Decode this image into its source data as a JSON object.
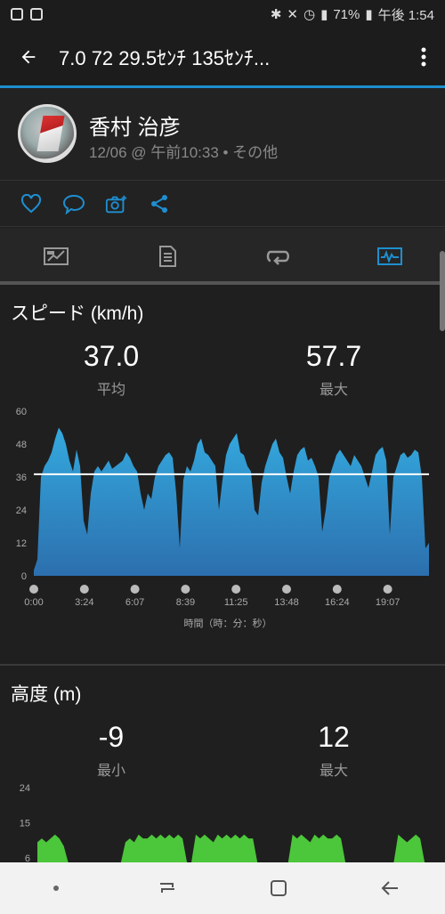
{
  "status": {
    "battery": "71%",
    "time": "午後 1:54"
  },
  "appbar": {
    "title": "7.0  72  29.5ｾﾝﾁ   135ｾﾝﾁ..."
  },
  "profile": {
    "name": "香村 治彦",
    "meta": "12/06 @ 午前10:33 • その他"
  },
  "colors": {
    "accent": "#1e8fd0",
    "speed_fill": "#2a8fc9",
    "altitude_fill": "#4cc63a"
  },
  "speed": {
    "title": "スピード (km/h)",
    "avg_value": "37.0",
    "avg_label": "平均",
    "max_value": "57.7",
    "max_label": "最大",
    "xlabel": "時間（時：分：秒）"
  },
  "altitude": {
    "title": "高度 (m)",
    "min_value": "-9",
    "min_label": "最小",
    "max_value": "12",
    "max_label": "最大"
  },
  "chart_data": [
    {
      "type": "area",
      "title": "スピード (km/h)",
      "xlabel": "時間（時：分：秒）",
      "ylabel": "",
      "ylim": [
        0,
        60
      ],
      "yticks": [
        "0",
        "12",
        "24",
        "36",
        "48",
        "60"
      ],
      "xticks": [
        "0:00",
        "3:24",
        "6:07",
        "8:39",
        "11:25",
        "13:48",
        "16:24",
        "19:07"
      ],
      "average": 37.0,
      "series": [
        {
          "values": [
            2,
            6,
            36,
            40,
            42,
            45,
            50,
            54,
            52,
            48,
            42,
            38,
            46,
            40,
            20,
            15,
            30,
            38,
            40,
            38,
            40,
            42,
            39,
            40,
            41,
            42,
            45,
            43,
            40,
            38,
            30,
            24,
            30,
            28,
            36,
            40,
            42,
            44,
            45,
            43,
            30,
            10,
            35,
            40,
            38,
            42,
            48,
            50,
            45,
            44,
            42,
            40,
            24,
            35,
            44,
            48,
            50,
            52,
            45,
            44,
            40,
            38,
            24,
            22,
            34,
            40,
            44,
            48,
            50,
            45,
            43,
            36,
            30,
            38,
            44,
            46,
            47,
            42,
            43,
            40,
            36,
            16,
            24,
            36,
            40,
            44,
            46,
            44,
            42,
            40,
            44,
            42,
            40,
            36,
            32,
            38,
            44,
            46,
            47,
            42,
            15,
            36,
            40,
            44,
            45,
            43,
            44,
            46,
            45,
            36,
            10,
            12
          ]
        }
      ]
    },
    {
      "type": "area",
      "title": "高度 (m)",
      "ylim": [
        6,
        24
      ],
      "yticks": [
        "6",
        "15",
        "24"
      ],
      "series": [
        {
          "values": [
            10,
            11,
            10,
            11,
            12,
            11,
            9,
            6,
            6,
            6,
            6,
            6,
            6,
            6,
            6,
            6,
            6,
            6,
            6,
            6,
            10,
            11,
            10,
            12,
            11,
            11,
            12,
            11,
            12,
            11,
            12,
            11,
            12,
            11,
            6,
            6,
            12,
            11,
            12,
            11,
            10,
            12,
            11,
            12,
            11,
            12,
            11,
            12,
            11,
            11,
            6,
            6,
            6,
            6,
            6,
            6,
            6,
            6,
            12,
            11,
            12,
            11,
            10,
            12,
            11,
            12,
            11,
            11,
            12,
            11,
            6,
            6,
            6,
            6,
            6,
            6,
            6,
            6,
            6,
            6,
            6,
            6,
            12,
            11,
            10,
            11,
            12,
            11,
            6,
            6
          ]
        }
      ]
    }
  ]
}
